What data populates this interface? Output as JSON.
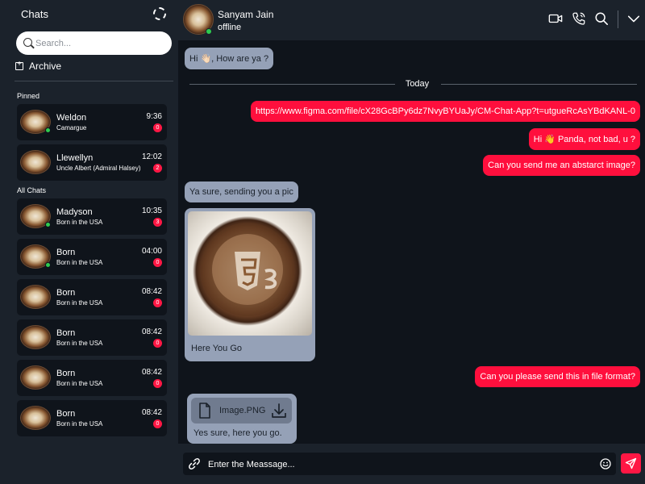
{
  "sidebar": {
    "title": "Chats",
    "search_placeholder": "Search...",
    "archive_label": "Archive",
    "pinned_label": "Pinned",
    "all_chats_label": "All Chats",
    "pinned": [
      {
        "name": "Weldon",
        "preview": "Camargue",
        "time": "9:36",
        "badge": "0",
        "online": true
      },
      {
        "name": "Llewellyn",
        "preview": "Uncle Albert (Admiral Halsey)",
        "time": "12:02",
        "badge": "2",
        "online": false
      }
    ],
    "all": [
      {
        "name": "Madyson",
        "preview": "Born in the USA",
        "time": "10:35",
        "badge": "3",
        "online": true
      },
      {
        "name": "Born",
        "preview": "Born in the USA",
        "time": "04:00",
        "badge": "0",
        "online": true
      },
      {
        "name": "Born",
        "preview": "Born in the USA",
        "time": "08:42",
        "badge": "0",
        "online": false
      },
      {
        "name": "Born",
        "preview": "Born in the USA",
        "time": "08:42",
        "badge": "0",
        "online": false
      },
      {
        "name": "Born",
        "preview": "Born in the USA",
        "time": "08:42",
        "badge": "0",
        "online": false
      },
      {
        "name": "Born",
        "preview": "Born in the USA",
        "time": "08:42",
        "badge": "0",
        "online": false
      }
    ]
  },
  "header": {
    "name": "Sanyam Jain",
    "status": "offline",
    "icons": [
      "video-call-icon",
      "phone-call-icon",
      "search-icon",
      "chevron-down-icon"
    ]
  },
  "messages": {
    "m1": "Hi 👋🏻, How are ya ?",
    "today": "Today",
    "m2": "https://www.figma.com/file/cX28GcBPy6dz7NvyBYUaJy/CM-Chat-App?t=utgueRcAsYBdKANL-0",
    "m3": "Hi 👋 Panda, not bad, u ?",
    "m4": "Can you send me an abstarct image?",
    "m5": "Ya sure, sending you a pic",
    "image_caption": "Here You Go",
    "m6": "Can you please send this in file format?",
    "file_name": "Image.PNG",
    "file_caption": "Yes sure, here you go."
  },
  "composer": {
    "placeholder": "Enter the Meassage..."
  },
  "colors": {
    "accent": "#ff1744",
    "incoming_bubble": "#95a1b7",
    "panel": "#1b222b",
    "background": "#0f141b",
    "online": "#2ecc50"
  }
}
